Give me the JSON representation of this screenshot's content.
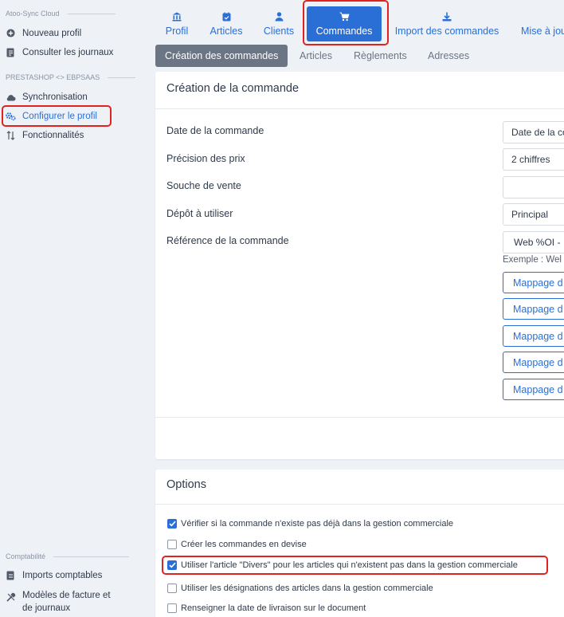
{
  "sidebar": {
    "section_atoo": "Atoo-Sync Cloud",
    "section_presta": "PRESTASHOP <> EBPSAAS",
    "section_compta": "Comptabilité",
    "items": [
      {
        "label": "Nouveau profil",
        "icon": "plus-circle-icon"
      },
      {
        "label": "Consulter les journaux",
        "icon": "journal-icon"
      },
      {
        "label": "Synchronisation",
        "icon": "cloud-sync-icon"
      },
      {
        "label": "Configurer le profil",
        "icon": "gears-icon",
        "active": true
      },
      {
        "label": "Fonctionnalités",
        "icon": "arrows-updown-icon"
      },
      {
        "label": "Imports comptables",
        "icon": "import-icon"
      },
      {
        "label": "Modèles de facture et",
        "label2": "de journaux",
        "icon": "tools-icon"
      }
    ]
  },
  "top_tabs": [
    {
      "label": "Profil",
      "icon": "bank-icon"
    },
    {
      "label": "Articles",
      "icon": "calendar-icon"
    },
    {
      "label": "Clients",
      "icon": "user-icon"
    },
    {
      "label": "Commandes",
      "icon": "cart-icon",
      "active": true
    },
    {
      "label": "Import des commandes",
      "icon": "download-icon"
    },
    {
      "label": "Mise à jou",
      "icon": ""
    }
  ],
  "sub_tabs": [
    "Création des commandes",
    "Articles",
    "Règlements",
    "Adresses"
  ],
  "creation_card": {
    "title": "Création de la commande",
    "fields": [
      {
        "label": "Date de la commande",
        "value": "Date de la co"
      },
      {
        "label": "Précision des prix",
        "value": "2 chiffres"
      },
      {
        "label": "Souche de vente",
        "value": ""
      },
      {
        "label": "Dépôt à utiliser",
        "value": "Principal"
      },
      {
        "label": "Référence de la commande",
        "value": "Web %OI -"
      }
    ],
    "example": "Exemple : Wel",
    "mapping_buttons": [
      "Mappage d",
      "Mappage d",
      "Mappage d",
      "Mappage d",
      "Mappage d"
    ]
  },
  "options_card": {
    "title": "Options",
    "options": [
      {
        "label": "Vérifier si la commande n'existe pas déjà dans la gestion commerciale",
        "checked": true
      },
      {
        "label": "Créer les commandes en devise",
        "checked": false
      },
      {
        "label": "Utiliser l'article \"Divers\" pour les articles qui n'existent pas dans la gestion commerciale",
        "checked": true
      },
      {
        "label": "Utiliser les désignations des articles dans la gestion commerciale",
        "checked": false
      },
      {
        "label": "Renseigner la date de livraison sur le document",
        "checked": false
      }
    ]
  },
  "colors": {
    "accent": "#2a6fd6",
    "highlight": "#e0231f",
    "background": "#eef1f6"
  }
}
